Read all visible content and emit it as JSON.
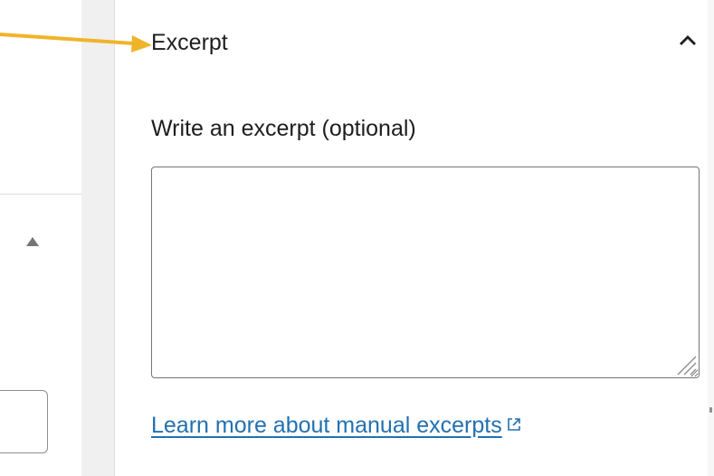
{
  "panel": {
    "title": "Excerpt",
    "collapse_icon": "chevron-up-icon"
  },
  "excerpt": {
    "label": "Write an excerpt (optional)",
    "value": "",
    "placeholder": ""
  },
  "learn_more": {
    "text": "Learn more about manual excerpts",
    "icon": "external-link-icon"
  },
  "colors": {
    "link": "#2271b1",
    "annotation_arrow": "#f0b429",
    "gutter": "#f0f0f1"
  }
}
